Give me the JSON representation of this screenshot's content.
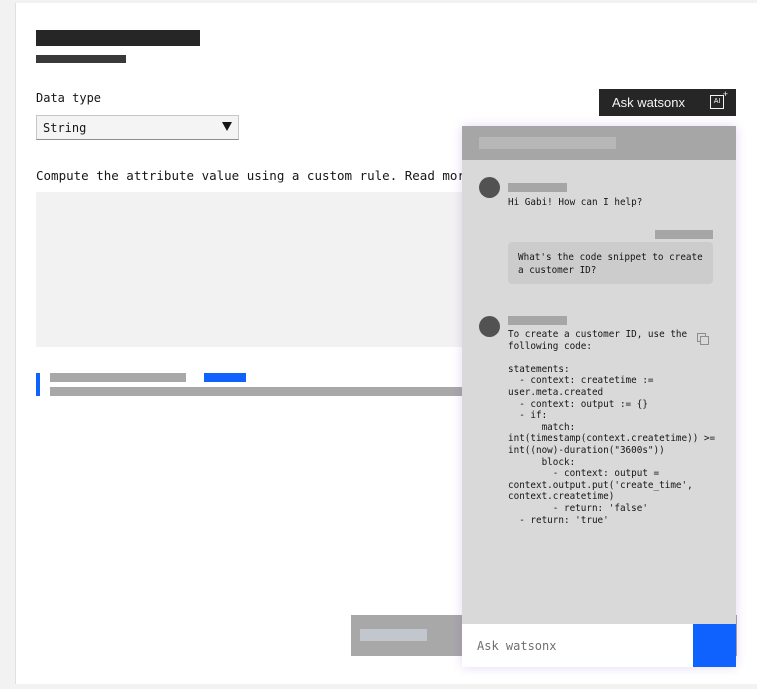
{
  "form": {
    "data_type_label": "Data type",
    "data_type_value": "String",
    "compute_text": "Compute the attribute value using a custom rule. Read more"
  },
  "ask_button": {
    "label": "Ask watsonx",
    "icon": "ai-icon",
    "icon_text": "AI"
  },
  "chat": {
    "greeting": "Hi Gabi! How can I help?",
    "user_message": "What's the code snippet to create\na customer ID?",
    "answer": "To create a customer ID, use the\nfollowing code:\n\nstatements:\n  - context: createtime :=\nuser.meta.created\n  - context: output := {}\n  - if:\n      match:\nint(timestamp(context.createtime)) >=\nint((now)-duration(\"3600s\"))\n      block:\n        - context: output =\ncontext.output.put('create_time',\ncontext.createtime)\n        - return: 'false'\n  - return: 'true'",
    "input_placeholder": "Ask watsonx"
  },
  "colors": {
    "accent": "#0f62fe",
    "dark": "#262626",
    "chat_bg": "#d9d9d9"
  }
}
